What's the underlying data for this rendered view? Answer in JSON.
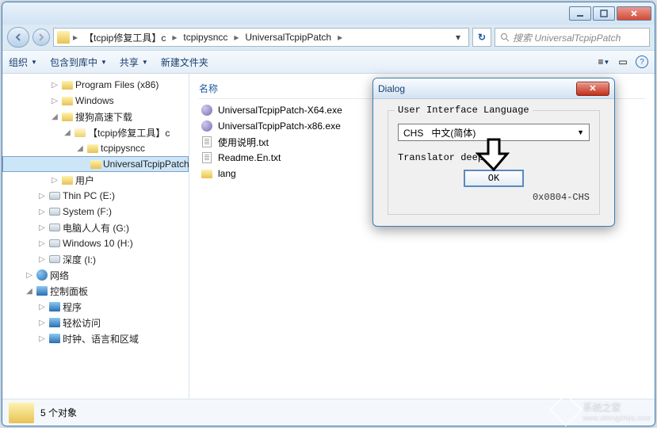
{
  "breadcrumb": {
    "items": [
      "【tcpip修复工具】c",
      "tcpipysncc",
      "UniversalTcpipPatch"
    ]
  },
  "search": {
    "placeholder": "搜索 UniversalTcpipPatch"
  },
  "toolbar": {
    "organize": "组织",
    "include": "包含到库中",
    "share": "共享",
    "newfolder": "新建文件夹"
  },
  "tree": [
    {
      "indent": 1,
      "icon": "folder",
      "expander": "▷",
      "label": "Program Files (x86)"
    },
    {
      "indent": 1,
      "icon": "folder",
      "expander": "▷",
      "label": "Windows"
    },
    {
      "indent": 1,
      "icon": "folder",
      "expander": "◢",
      "label": "搜狗高速下载"
    },
    {
      "indent": 2,
      "icon": "folder-open",
      "expander": "◢",
      "label": "【tcpip修复工具】c"
    },
    {
      "indent": 3,
      "icon": "folder",
      "expander": "◢",
      "label": "tcpipysncc"
    },
    {
      "indent": 4,
      "icon": "folder",
      "expander": "",
      "label": "UniversalTcpipPatch",
      "selected": true
    },
    {
      "indent": 1,
      "icon": "folder",
      "expander": "▷",
      "label": "用户"
    },
    {
      "indent": 0,
      "icon": "drive",
      "expander": "▷",
      "label": "Thin PC (E:)"
    },
    {
      "indent": 0,
      "icon": "drive",
      "expander": "▷",
      "label": "System (F:)"
    },
    {
      "indent": 0,
      "icon": "drive",
      "expander": "▷",
      "label": "电脑人人有 (G:)"
    },
    {
      "indent": 0,
      "icon": "drive",
      "expander": "▷",
      "label": "Windows 10 (H:)"
    },
    {
      "indent": 0,
      "icon": "drive",
      "expander": "▷",
      "label": "深度 (I:)"
    },
    {
      "indent": -1,
      "icon": "network",
      "expander": "▷",
      "label": "网络"
    },
    {
      "indent": -1,
      "icon": "cpanel",
      "expander": "◢",
      "label": "控制面板"
    },
    {
      "indent": 0,
      "icon": "cp-sub",
      "expander": "▷",
      "label": "程序"
    },
    {
      "indent": 0,
      "icon": "cp-sub",
      "expander": "▷",
      "label": "轻松访问"
    },
    {
      "indent": 0,
      "icon": "cp-sub",
      "expander": "▷",
      "label": "时钟、语言和区域"
    }
  ],
  "files": {
    "header": "名称",
    "items": [
      {
        "icon": "exe",
        "name": "UniversalTcpipPatch-X64.exe"
      },
      {
        "icon": "exe",
        "name": "UniversalTcpipPatch-x86.exe"
      },
      {
        "icon": "txt",
        "name": "使用说明.txt"
      },
      {
        "icon": "txt",
        "name": "Readme.En.txt"
      },
      {
        "icon": "folder",
        "name": "lang"
      }
    ]
  },
  "status": {
    "count": "5 个对象"
  },
  "dialog": {
    "title": "Dialog",
    "legend": "User Interface Language",
    "select_code": "CHS",
    "select_label": "中文(简体)",
    "translator": "Translator deep",
    "ok": "OK",
    "code": "0x0804-CHS"
  },
  "watermark": {
    "text": "系统之家",
    "sub": "www.xitongzhijia.com"
  }
}
